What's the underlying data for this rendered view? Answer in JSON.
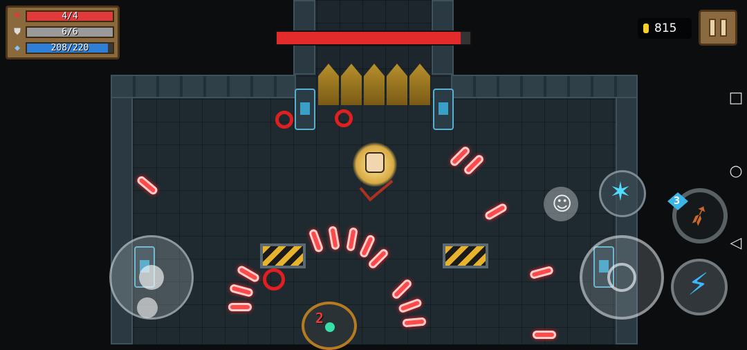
{
  "hud": {
    "health": {
      "text": "4/4",
      "fraction": 1.0,
      "color": "#e03a3a",
      "icon": "heart-icon"
    },
    "armor": {
      "text": "6/6",
      "fraction": 1.0,
      "color": "#9a9a9a",
      "icon": "shield-icon"
    },
    "energy": {
      "text": "208/220",
      "fraction": 0.945,
      "color": "#2f7fd6",
      "icon": "energy-crystal-icon"
    }
  },
  "boss": {
    "health_fraction": 0.95,
    "color": "#e32b2b"
  },
  "coins": {
    "value": "815",
    "icon": "gold-coin-icon"
  },
  "weapon": {
    "energy_cost": "3",
    "icon": "bow-icon"
  },
  "damage_popup": "2",
  "controls": {
    "joystick": "movement-joystick",
    "attack": "crosshair-icon",
    "skill": "lightning-icon",
    "dash": "claw-icon",
    "emote": "smile-icon",
    "pause": "pause-icon"
  },
  "android_nav": {
    "recent": "□",
    "home": "○",
    "back": "◁"
  },
  "colors": {
    "bullet": "#ff4a4a",
    "floor": "#1f2a30",
    "accent": "#3ab7ff"
  }
}
